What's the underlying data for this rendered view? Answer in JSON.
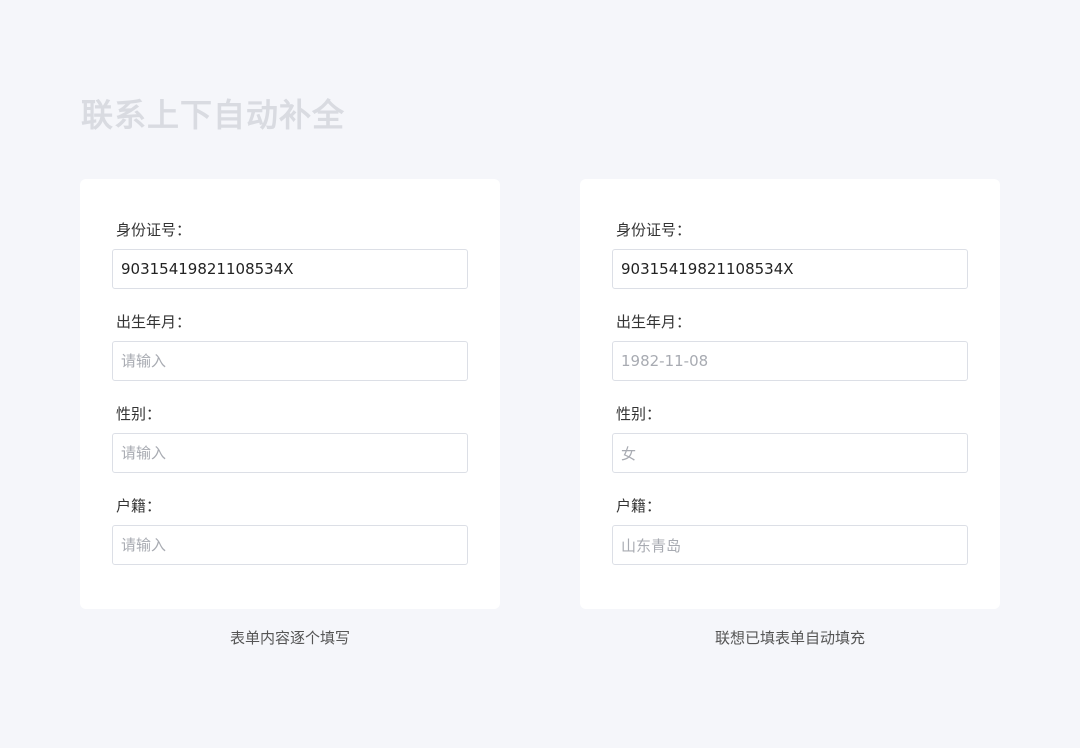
{
  "title": "联系上下自动补全",
  "panels": [
    {
      "caption": "表单内容逐个填写",
      "fields": [
        {
          "label": "身份证号：",
          "value": "90315419821108534X",
          "placeholder": ""
        },
        {
          "label": "出生年月：",
          "value": "",
          "placeholder": "请输入"
        },
        {
          "label": "性别：",
          "value": "",
          "placeholder": "请输入"
        },
        {
          "label": "户籍：",
          "value": "",
          "placeholder": "请输入"
        }
      ]
    },
    {
      "caption": "联想已填表单自动填充",
      "fields": [
        {
          "label": "身份证号：",
          "value": "90315419821108534X",
          "placeholder": ""
        },
        {
          "label": "出生年月：",
          "value": "1982-11-08",
          "placeholder": ""
        },
        {
          "label": "性别：",
          "value": "女",
          "placeholder": ""
        },
        {
          "label": "户籍：",
          "value": "山东青岛",
          "placeholder": ""
        }
      ]
    }
  ]
}
